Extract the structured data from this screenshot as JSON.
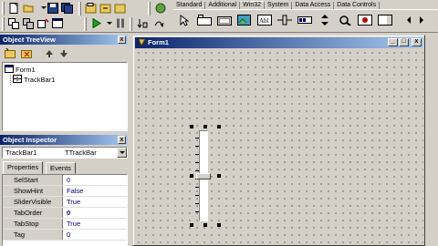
{
  "toolbar": {
    "icons_row1": [
      "new-icon",
      "open-icon",
      "save-icon",
      "save-all-icon",
      "open-project-icon",
      "save-project-icon"
    ],
    "icons_row2": [
      "view-unit-icon",
      "view-form-icon",
      "toggle-form-unit-icon",
      "new-form-icon",
      "run-icon",
      "run-dropdown-icon",
      "pause-icon",
      "trace-into-icon",
      "step-over-icon"
    ]
  },
  "palette": {
    "tabs": [
      "Standard",
      "Additional",
      "Win32",
      "System",
      "Data Access",
      "Data Controls"
    ],
    "active_tab": "Win32",
    "icons": [
      "pointer-icon",
      "tabcontrol-icon",
      "pagecontrol-icon",
      "imagelist-icon",
      "richedit-icon",
      "trackbar-icon",
      "progressbar-icon",
      "updown-icon",
      "hotkey-icon",
      "animate-icon"
    ]
  },
  "tree_view": {
    "title": "Object TreeView",
    "close": "x",
    "nodes": [
      {
        "label": "Form1",
        "level": 0
      },
      {
        "label": "TrackBar1",
        "level": 1
      }
    ]
  },
  "inspector": {
    "title": "Object Inspector",
    "close": "x",
    "selected_object": "TrackBar1",
    "selected_type": "TTrackBar",
    "tabs": [
      "Properties",
      "Events"
    ],
    "active_tab": "Properties",
    "properties": [
      {
        "name": "SelStart",
        "value": "0"
      },
      {
        "name": "ShowHint",
        "value": "False"
      },
      {
        "name": "SliderVisible",
        "value": "True"
      },
      {
        "name": "TabOrder",
        "value": "0"
      },
      {
        "name": "TabStop",
        "value": "True"
      },
      {
        "name": "Tag",
        "value": "0"
      }
    ]
  },
  "form": {
    "title": "Form1",
    "minimize": "_",
    "maximize": "□",
    "close": "x"
  },
  "colors": {
    "title_active": "#0a246a",
    "title_gradient_end": "#a6caf0",
    "face": "#d4d0c8"
  }
}
